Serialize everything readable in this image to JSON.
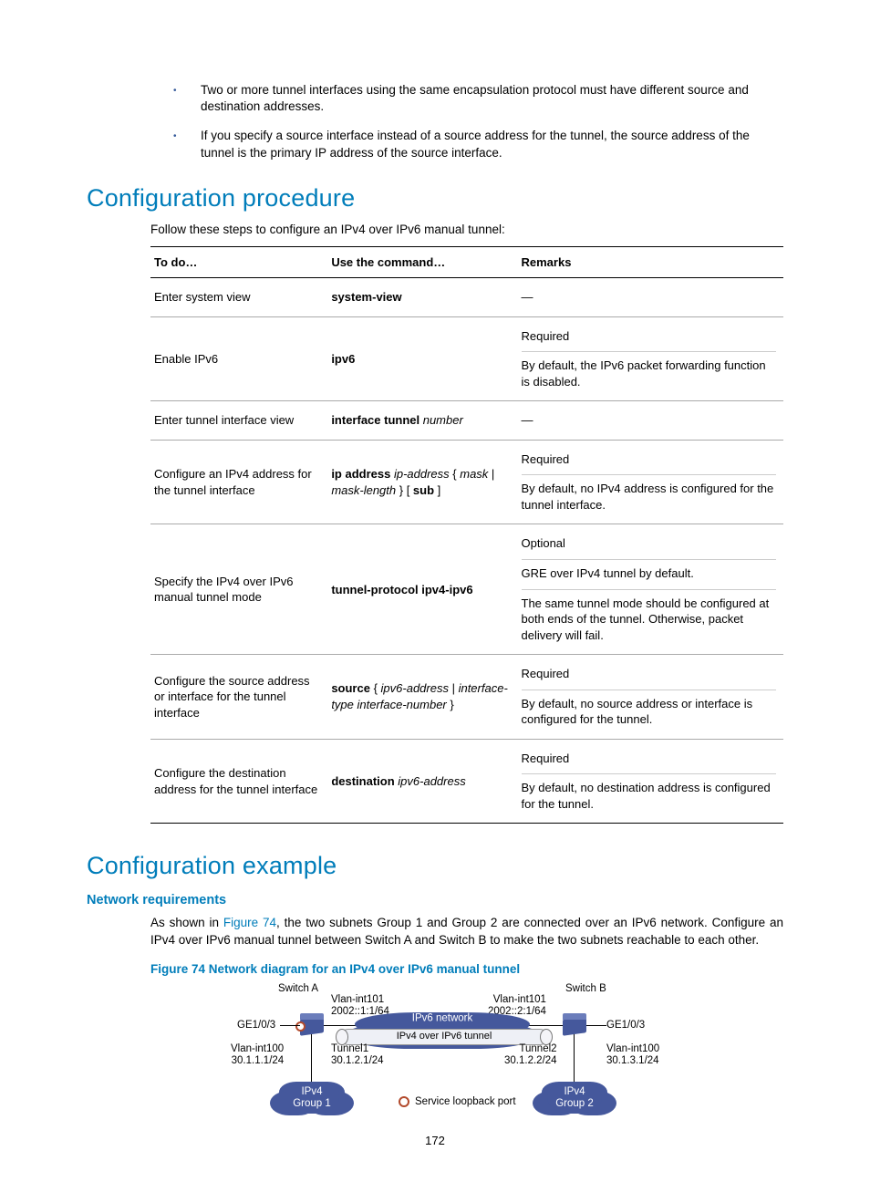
{
  "bullets": [
    "Two or more tunnel interfaces using the same encapsulation protocol must have different source and destination addresses.",
    "If you specify a source interface instead of a source address for the tunnel, the source address of the tunnel is the primary IP address of the source interface."
  ],
  "headings": {
    "proc": "Configuration procedure",
    "example": "Configuration example",
    "netreq": "Network requirements"
  },
  "proc_intro": "Follow these steps to configure an IPv4 over IPv6 manual tunnel:",
  "table": {
    "h1": "To do…",
    "h2": "Use the command…",
    "h3": "Remarks",
    "rows": [
      {
        "todo": "Enter system view",
        "cmd_bold": "system-view",
        "cmd_ital": "",
        "remarks": [
          "—"
        ]
      },
      {
        "todo": "Enable IPv6",
        "cmd_bold": "ipv6",
        "cmd_ital": "",
        "remarks": [
          "Required",
          "By default, the IPv6 packet forwarding function is disabled."
        ]
      },
      {
        "todo": "Enter tunnel interface view",
        "cmd_bold": "interface tunnel",
        "cmd_ital": " number",
        "remarks": [
          "—"
        ]
      },
      {
        "todo": "Configure an IPv4 address for the tunnel interface",
        "cmd_html": "<b>ip address</b> <i>ip-address</i> { <i>mask</i> | <i>mask-length</i> } [ <b>sub</b> ]",
        "remarks": [
          "Required",
          "By default, no IPv4 address is configured for the tunnel interface."
        ]
      },
      {
        "todo": "Specify the IPv4 over IPv6 manual tunnel mode",
        "cmd_bold": "tunnel-protocol ipv4-ipv6",
        "cmd_ital": "",
        "remarks": [
          "Optional",
          "GRE over IPv4 tunnel by default.",
          "The same tunnel mode should be configured at both ends of the tunnel. Otherwise, packet delivery will fail."
        ]
      },
      {
        "todo": "Configure the source address or interface for the tunnel interface",
        "cmd_html": "<b>source</b> { <i>ipv6-address</i> | <i>interface-type interface-number</i> }",
        "remarks": [
          "Required",
          "By default, no source address or interface is configured for the tunnel."
        ]
      },
      {
        "todo": "Configure the destination address for the tunnel interface",
        "cmd_html": "<b>destination</b> <i>ipv6-address</i>",
        "remarks": [
          "Required",
          "By default, no destination address is configured for the tunnel."
        ]
      }
    ]
  },
  "example_para_pre": "As shown in ",
  "fig_link": "Figure 74",
  "example_para_post": ", the two subnets Group 1 and Group 2 are connected over an IPv6 network. Configure an IPv4 over IPv6 manual tunnel between Switch A and Switch B to make the two subnets reachable to each other.",
  "fig_caption": "Figure 74 Network diagram for an IPv4 over IPv6 manual tunnel",
  "diagram": {
    "switchA": "Switch A",
    "switchB": "Switch B",
    "vlan101A": "Vlan-int101\n2002::1:1/64",
    "vlan101B": "Vlan-int101\n2002::2:1/64",
    "ge_left": "GE1/0/3",
    "ge_right": "GE1/0/3",
    "vlan100A": "Vlan-int100\n30.1.1.1/24",
    "vlan100B": "Vlan-int100\n30.1.3.1/24",
    "tunnel1": "Tunnel1\n30.1.2.1/24",
    "tunnel2": "Tunnel2\n30.1.2.2/24",
    "ipv6net": "IPv6 network",
    "tube": "IPv4 over IPv6 tunnel",
    "group1": "IPv4\nGroup 1",
    "group2": "IPv4\nGroup 2",
    "legend": "Service loopback port"
  },
  "page_number": "172"
}
